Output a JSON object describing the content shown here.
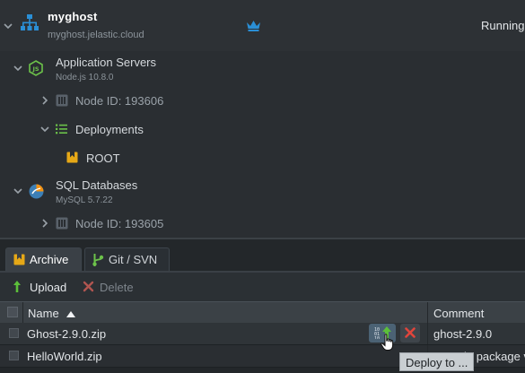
{
  "environment": {
    "name": "myghost",
    "url": "myghost.jelastic.cloud",
    "status": "Running",
    "crown_icon": "crown-icon",
    "accent": "#2a8fd6"
  },
  "tree": {
    "app_servers": {
      "label": "Application Servers",
      "sub": "Node.js 10.8.0",
      "icon": "nodejs-icon"
    },
    "app_node": {
      "label": "Node ID: 193606"
    },
    "deployments": {
      "label": "Deployments",
      "icon": "list-icon"
    },
    "root": {
      "label": "ROOT",
      "icon": "package-icon"
    },
    "sql": {
      "label": "SQL Databases",
      "sub": "MySQL 5.7.22",
      "icon": "mysql-icon"
    },
    "sql_node": {
      "label": "Node ID: 193605"
    }
  },
  "panel": {
    "tabs": [
      {
        "label": "Archive",
        "icon": "archive-icon",
        "active": true
      },
      {
        "label": "Git / SVN",
        "icon": "git-icon",
        "active": false
      }
    ],
    "toolbar": {
      "upload_label": "Upload",
      "delete_label": "Delete"
    },
    "columns": [
      "Name",
      "Comment"
    ],
    "rows": [
      {
        "name": "Ghost-2.9.0.zip",
        "comment": "ghost-2.9.0"
      },
      {
        "name": "HelloWorld.zip",
        "comment": "Sample package v"
      }
    ],
    "tooltip": "Deploy to ..."
  },
  "colors": {
    "delete_red": "#e0453c",
    "upload_green": "#5cbf3a",
    "folder_yellow": "#e6a817"
  }
}
